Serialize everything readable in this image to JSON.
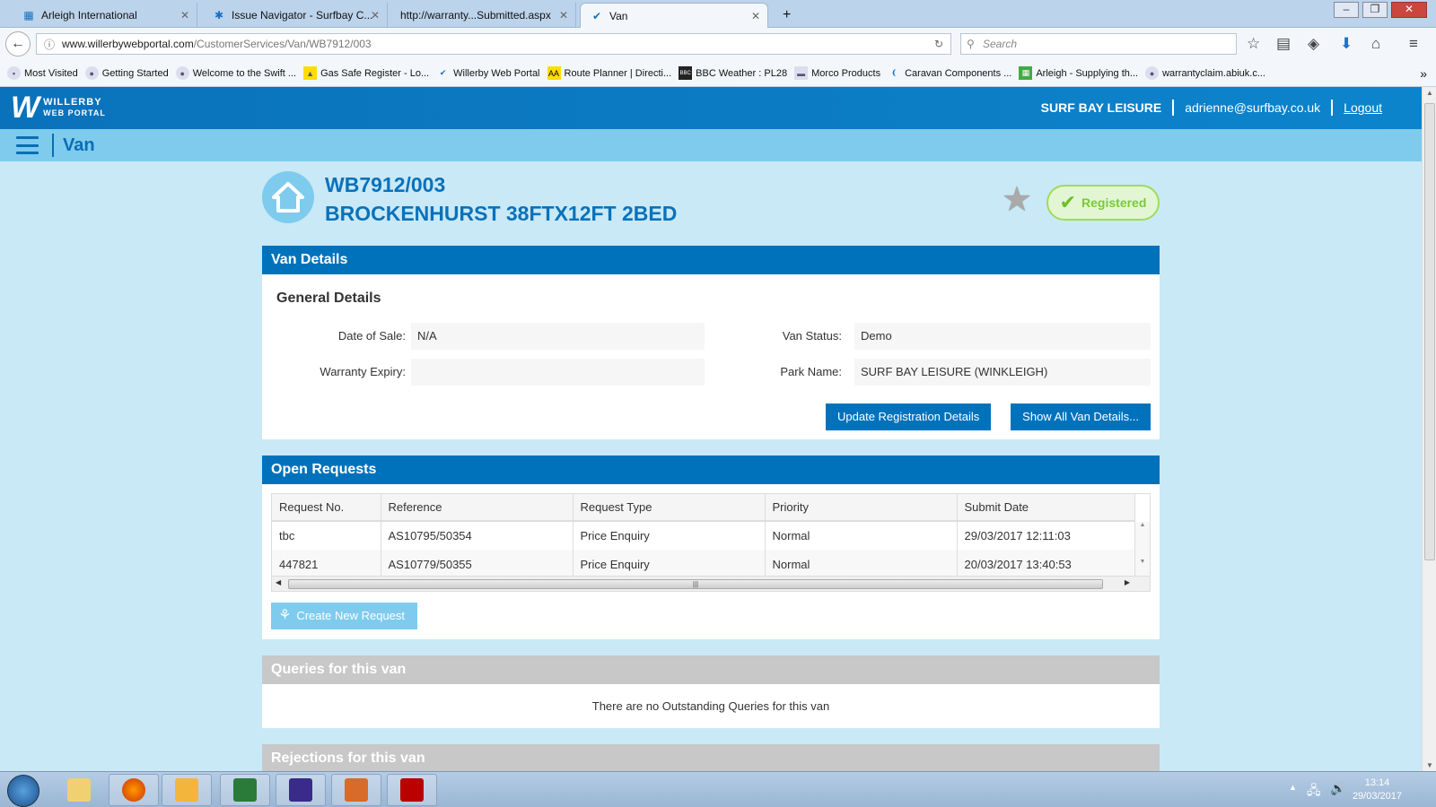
{
  "browser": {
    "tabs": [
      {
        "label": "Arleigh International",
        "icon": "arleigh-icon"
      },
      {
        "label": "Issue Navigator - Surfbay C...",
        "icon": "jira-icon"
      },
      {
        "label": "http://warranty...Submitted.aspx",
        "icon": ""
      },
      {
        "label": "Van",
        "icon": "willerby-icon"
      }
    ],
    "url_domain": "www.willerbywebportal.com",
    "url_path": "/CustomerServices/Van/WB7912/003",
    "search_placeholder": "Search",
    "bookmarks": [
      "Most Visited",
      "Getting Started",
      "Welcome to the Swift ...",
      "Gas Safe Register - Lo...",
      "Willerby Web Portal",
      "Route Planner | Directi...",
      "BBC Weather : PL28",
      "Morco Products",
      "Caravan Components ...",
      "Arleigh - Supplying th...",
      "warrantyclaim.abiuk.c..."
    ]
  },
  "site": {
    "logo_top": "WILLERBY",
    "logo_bottom": "WEB PORTAL",
    "company": "SURF BAY LEISURE",
    "email": "adrienne@surfbay.co.uk",
    "logout": "Logout",
    "page": "Van"
  },
  "van": {
    "id": "WB7912/003",
    "model": "BROCKENHURST 38FTX12FT 2BED",
    "status_badge": "Registered"
  },
  "details": {
    "header": "Van Details",
    "subheader": "General Details",
    "date_of_sale_label": "Date of Sale:",
    "date_of_sale": "N/A",
    "warranty_expiry_label": "Warranty Expiry:",
    "warranty_expiry": "",
    "van_status_label": "Van Status:",
    "van_status": "Demo",
    "park_name_label": "Park Name:",
    "park_name": "SURF BAY LEISURE (WINKLEIGH)",
    "update_btn": "Update Registration Details",
    "show_all_btn": "Show All Van Details..."
  },
  "requests": {
    "header": "Open Requests",
    "columns": [
      "Request No.",
      "Reference",
      "Request Type",
      "Priority",
      "Submit Date"
    ],
    "rows": [
      [
        "tbc",
        "AS10795/50354",
        "Price Enquiry",
        "Normal",
        "29/03/2017 12:11:03"
      ],
      [
        "447821",
        "AS10779/50355",
        "Price Enquiry",
        "Normal",
        "20/03/2017 13:40:53"
      ]
    ],
    "create_btn": "Create New Request"
  },
  "queries": {
    "header": "Queries for this van",
    "empty": "There are no Outstanding Queries for this van"
  },
  "rejections": {
    "header": "Rejections for this van"
  },
  "taskbar": {
    "time": "13:14",
    "date": "29/03/2017"
  }
}
